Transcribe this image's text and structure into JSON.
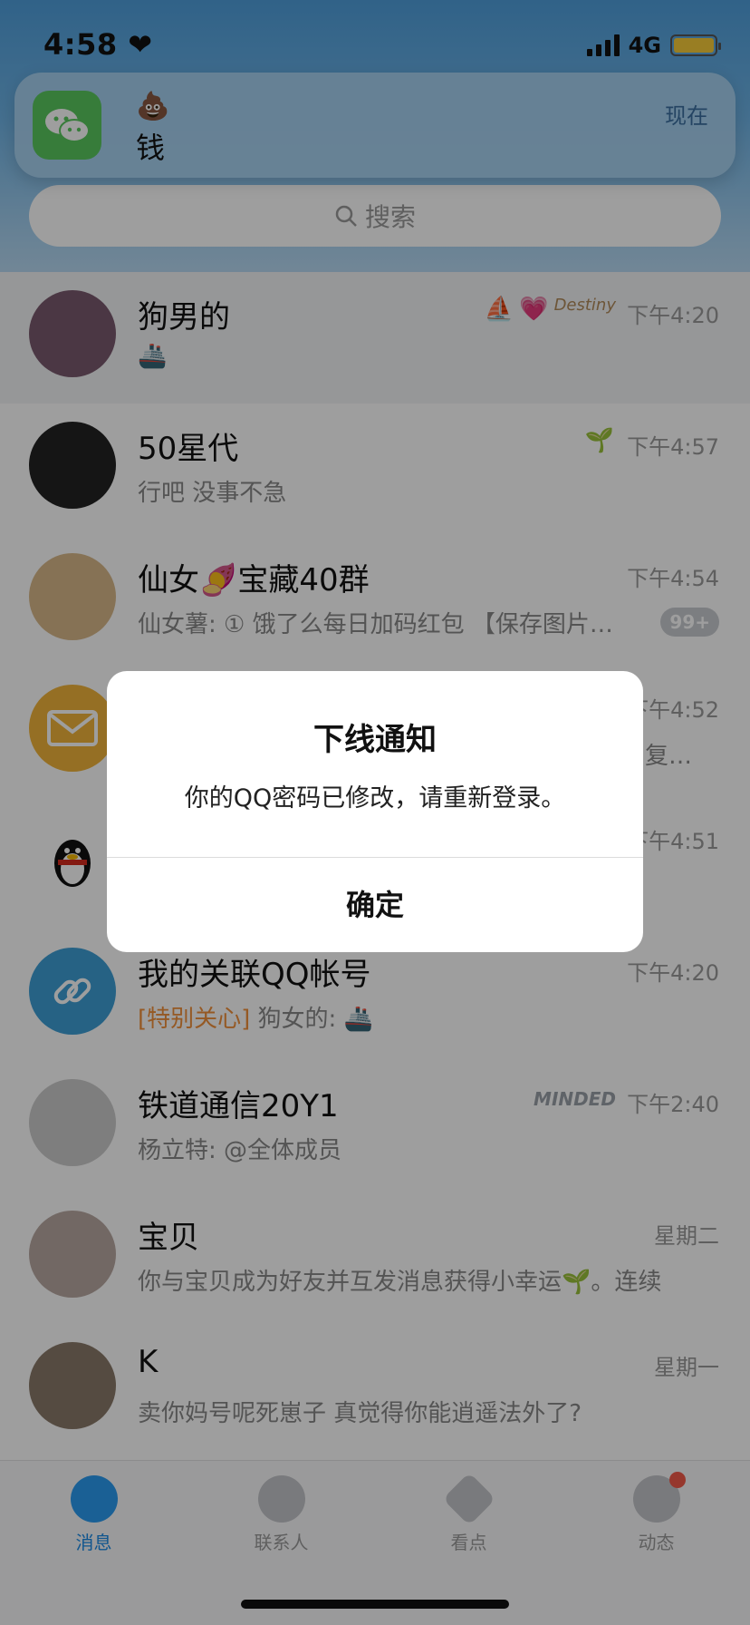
{
  "status_bar": {
    "time": "4:58",
    "time_icon": "heart-icon",
    "network": "4G",
    "signal_icon": "signal-bars-icon",
    "battery_icon": "battery-icon",
    "battery_color": "#f7cc39"
  },
  "notification": {
    "app_icon": "wechat-icon",
    "emoji": "💩",
    "text": "钱",
    "time": "现在"
  },
  "search": {
    "placeholder": "搜索",
    "icon": "search-icon"
  },
  "chats": [
    {
      "name": "狗男的",
      "preview": "🚢",
      "time": "下午4:20",
      "pinned": true,
      "icons": [
        "⛵",
        "💗",
        "Destiny"
      ],
      "avatar_color": "#7a5a6e"
    },
    {
      "name": "50星代",
      "preview": "行吧 没事不急",
      "time": "下午4:57",
      "pinned": false,
      "icons": [
        "🌱"
      ],
      "avatar_color": "#222222"
    },
    {
      "name": "仙女🍠宝藏40群",
      "preview": "仙女薯: ① 饿了么每日加码红包 【保存图片…",
      "time": "下午4:54",
      "badge": "99+",
      "avatar_color": "#d9b98a"
    },
    {
      "name": "",
      "preview": "复…",
      "time": "下午4:52",
      "avatar_color": "#f1b43a"
    },
    {
      "name": "",
      "preview": "",
      "time": "下午4:51",
      "avatar_color": "#ffffff"
    },
    {
      "name": "我的关联QQ帐号",
      "tag": "[特别关心]",
      "preview": " 狗女的: 🚢",
      "time": "下午4:20",
      "avatar_color": "#3e9fd6"
    },
    {
      "name": "铁道通信20Y1",
      "preview": "杨立特: @全体成员",
      "time": "下午2:40",
      "icons": [
        "MINDED"
      ],
      "avatar_color": "#cccccc"
    },
    {
      "name": "宝贝",
      "preview": "你与宝贝成为好友并互发消息获得小幸运🌱。连续",
      "time": "星期二",
      "avatar_color": "#b9a8a2"
    },
    {
      "name": "K",
      "preview": "卖你妈号呢死崽子 真觉得你能逍遥法外了?",
      "time": "星期一",
      "avatar_color": "#8a7a6a"
    }
  ],
  "tabbar": {
    "tabs": [
      {
        "label": "消息",
        "icon": "messages-icon",
        "active": true
      },
      {
        "label": "联系人",
        "icon": "contacts-icon"
      },
      {
        "label": "看点",
        "icon": "eye-icon"
      },
      {
        "label": "动态",
        "icon": "star-planet-icon"
      }
    ]
  },
  "dialog": {
    "title": "下线通知",
    "message": "你的QQ密码已修改，请重新登录。",
    "confirm": "确定"
  }
}
